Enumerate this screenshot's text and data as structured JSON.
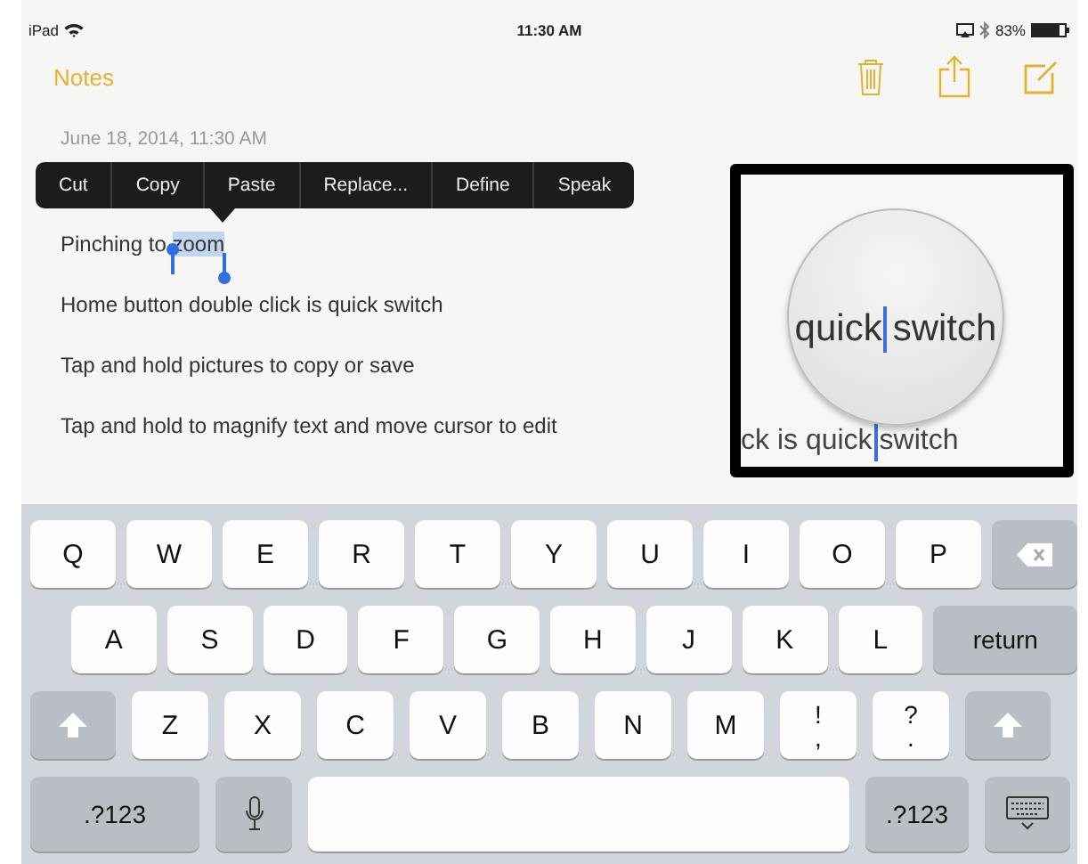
{
  "status_bar": {
    "device": "iPad",
    "time": "11:30 AM",
    "battery": "83%"
  },
  "nav": {
    "back": "Notes"
  },
  "note": {
    "date": "June 18, 2014, 11:30 AM",
    "lines": [
      {
        "text": "Pinching to ",
        "selection": "zoom"
      },
      {
        "text": "Home button double click is quick switch"
      },
      {
        "text": "Tap and hold pictures to copy or save"
      },
      {
        "text": "Tap and hold to magnify text and move cursor to edit"
      }
    ]
  },
  "edit_menu": [
    "Cut",
    "Copy",
    "Paste",
    "Replace...",
    "Define",
    "Speak"
  ],
  "magnifier": {
    "loupe_before": "quick",
    "loupe_after": "switch",
    "line_before": "ck is quick",
    "line_after": "switch"
  },
  "keyboard": {
    "rows": [
      {
        "keys": [
          {
            "kind": "letter",
            "label": "Q"
          },
          {
            "kind": "letter",
            "label": "W"
          },
          {
            "kind": "letter",
            "label": "E"
          },
          {
            "kind": "letter",
            "label": "R"
          },
          {
            "kind": "letter",
            "label": "T"
          },
          {
            "kind": "letter",
            "label": "Y"
          },
          {
            "kind": "letter",
            "label": "U"
          },
          {
            "kind": "letter",
            "label": "I"
          },
          {
            "kind": "letter",
            "label": "O"
          },
          {
            "kind": "letter",
            "label": "P"
          },
          {
            "kind": "backspace"
          }
        ]
      },
      {
        "keys": [
          {
            "kind": "letter",
            "label": "A"
          },
          {
            "kind": "letter",
            "label": "S"
          },
          {
            "kind": "letter",
            "label": "D"
          },
          {
            "kind": "letter",
            "label": "F"
          },
          {
            "kind": "letter",
            "label": "G"
          },
          {
            "kind": "letter",
            "label": "H"
          },
          {
            "kind": "letter",
            "label": "J"
          },
          {
            "kind": "letter",
            "label": "K"
          },
          {
            "kind": "letter",
            "label": "L"
          },
          {
            "kind": "return",
            "label": "return"
          }
        ]
      },
      {
        "keys": [
          {
            "kind": "shift"
          },
          {
            "kind": "letter",
            "label": "Z"
          },
          {
            "kind": "letter",
            "label": "X"
          },
          {
            "kind": "letter",
            "label": "C"
          },
          {
            "kind": "letter",
            "label": "V"
          },
          {
            "kind": "letter",
            "label": "B"
          },
          {
            "kind": "letter",
            "label": "N"
          },
          {
            "kind": "letter",
            "label": "M"
          },
          {
            "kind": "punct",
            "top": "!",
            "bottom": ","
          },
          {
            "kind": "punct",
            "top": "?",
            "bottom": "."
          },
          {
            "kind": "shift"
          }
        ]
      },
      {
        "keys": [
          {
            "kind": "mode",
            "label": ".?123"
          },
          {
            "kind": "mic"
          },
          {
            "kind": "space"
          },
          {
            "kind": "mode",
            "label": ".?123"
          },
          {
            "kind": "dismiss"
          }
        ]
      }
    ]
  }
}
